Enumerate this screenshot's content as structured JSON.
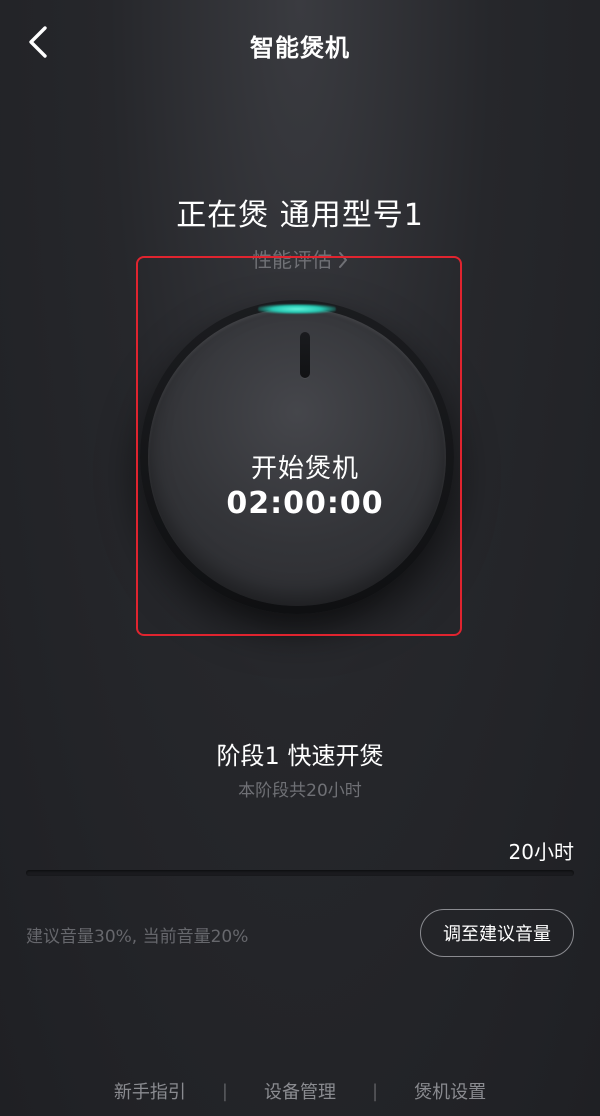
{
  "header": {
    "title": "智能煲机",
    "back_icon": "chevron-left-icon"
  },
  "status": {
    "title": "正在煲 通用型号1",
    "perf_link": "性能评估",
    "perf_link_icon": "chevron-right-icon"
  },
  "dial": {
    "label": "开始煲机",
    "time": "02:00:00",
    "glow_color": "#3fe3c8"
  },
  "stage": {
    "title": "阶段1 快速开煲",
    "subtitle": "本阶段共20小时",
    "duration": "20小时",
    "progress": 0
  },
  "volume": {
    "text": "建议音量30%, 当前音量20%",
    "button_label": "调至建议音量"
  },
  "footer": {
    "items": [
      {
        "label": "新手指引"
      },
      {
        "label": "设备管理"
      },
      {
        "label": "煲机设置"
      }
    ]
  },
  "colors": {
    "background": "#26272b",
    "highlight_border": "#e0242f",
    "muted_text": "#6f7075"
  }
}
